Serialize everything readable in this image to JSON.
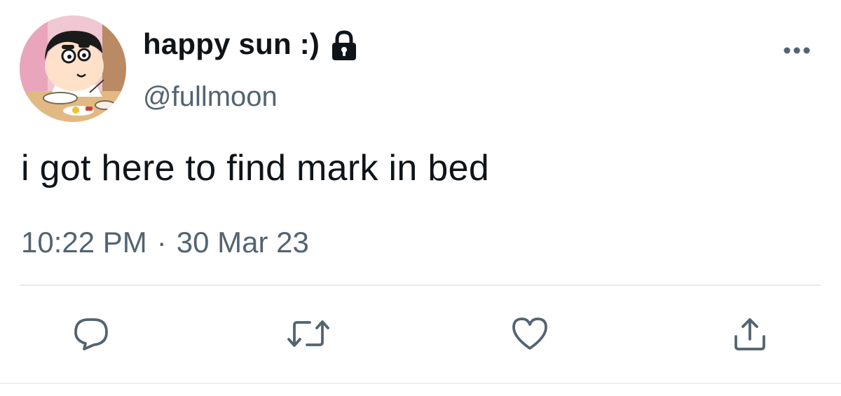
{
  "author": {
    "display_name": "happy sun :)",
    "handle": "@fullmoon",
    "protected": true
  },
  "tweet": {
    "text": "i got here to find mark in bed",
    "time": "10:22 PM",
    "separator": "·",
    "date": "30 Mar 23"
  },
  "icons": {
    "avatar": "avatar-image",
    "lock": "lock-icon",
    "more": "more-options-icon",
    "reply": "reply-icon",
    "retweet": "retweet-icon",
    "like": "heart-icon",
    "share": "share-icon"
  },
  "colors": {
    "text_primary": "#0f1419",
    "text_secondary": "#536471",
    "icon": "#536471",
    "divider": "#e6e9eb"
  }
}
